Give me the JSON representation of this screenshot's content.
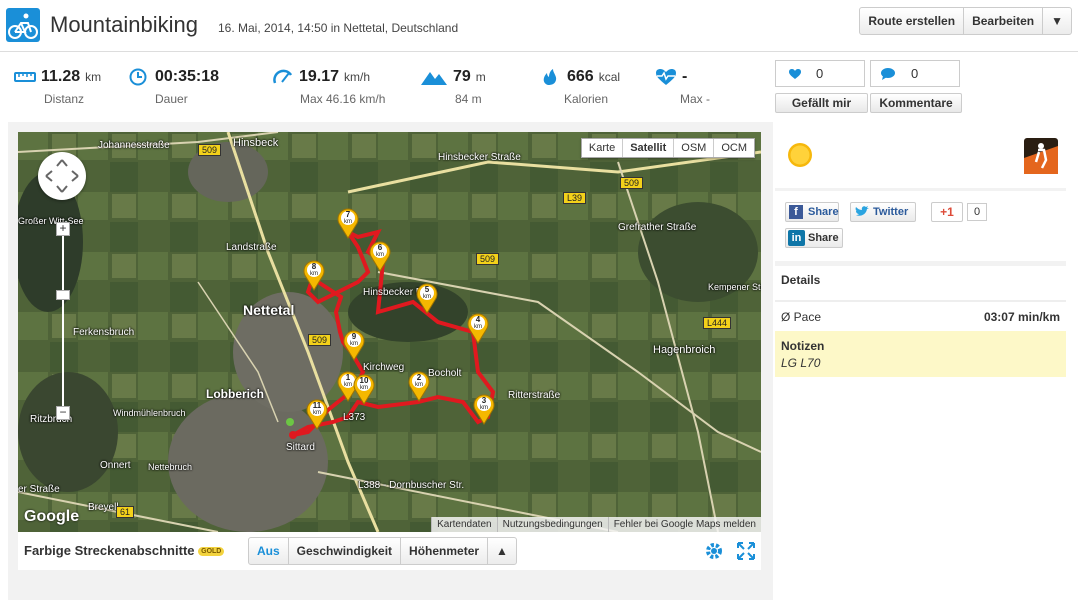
{
  "header": {
    "title": "Mountainbiking",
    "subtitle": "16. Mai, 2014, 14:50 in Nettetal, Deutschland",
    "buttons": {
      "create_route": "Route erstellen",
      "edit": "Bearbeiten",
      "menu": "▼"
    }
  },
  "stats": [
    {
      "icon": "ruler-icon",
      "value": "11.28",
      "unit": "km",
      "label": "Distanz"
    },
    {
      "icon": "clock-icon",
      "value": "00:35:18",
      "unit": "",
      "label": "Dauer"
    },
    {
      "icon": "speedometer-icon",
      "value": "19.17",
      "unit": "km/h",
      "label": "Max 46.16 km/h"
    },
    {
      "icon": "mountain-icon",
      "value": "79",
      "unit": "m",
      "label": "84 m"
    },
    {
      "icon": "flame-icon",
      "value": "666",
      "unit": "kcal",
      "label": "Kalorien"
    },
    {
      "icon": "heartrate-icon",
      "value": "-",
      "unit": "",
      "label": "Max -"
    }
  ],
  "social": {
    "likes": "0",
    "comments": "0",
    "like_label": "Gefällt mir",
    "comment_label": "Kommentare"
  },
  "map": {
    "types": [
      "Karte",
      "Satellit",
      "OSM",
      "OCM"
    ],
    "active_type": "Satellit",
    "zoom_plus": "+",
    "zoom_minus": "−",
    "attribution": [
      "Kartendaten",
      "Nutzungsbedingungen",
      "Fehler bei Google Maps melden"
    ],
    "google_logo": "Google",
    "place_labels": [
      {
        "text": "Nettetal"
      },
      {
        "text": "Lobberich"
      },
      {
        "text": "Hinsbeck"
      },
      {
        "text": "Hagenbroich"
      },
      {
        "text": "Ferkensbruch"
      },
      {
        "text": "Windmühlenbruch"
      },
      {
        "text": "Nettebruch"
      },
      {
        "text": "Onnert"
      },
      {
        "text": "Breyell"
      },
      {
        "text": "Ritzbruch"
      },
      {
        "text": "Johannesstraße"
      },
      {
        "text": "Hinsbecker Straße"
      },
      {
        "text": "Ritterstraße"
      },
      {
        "text": "Sittard"
      },
      {
        "text": "Bocholt"
      },
      {
        "text": "Kirchweg"
      },
      {
        "text": "Großer Witt-See"
      },
      {
        "text": "Landstraße"
      },
      {
        "text": "Grefrather Straße"
      },
      {
        "text": "Kempener Str."
      },
      {
        "text": "L388 - Dornbuscher Str."
      },
      {
        "text": "L373"
      },
      {
        "text": "er Straße"
      },
      {
        "text": "Hinsbecker Berg"
      }
    ],
    "road_badges": [
      "509",
      "509",
      "509",
      "509",
      "61",
      "L39",
      "L444"
    ],
    "markers": [
      "1",
      "2",
      "3",
      "4",
      "5",
      "6",
      "7",
      "8",
      "9",
      "10",
      "11"
    ],
    "marker_unit": "km"
  },
  "segments": {
    "title": "Farbige Streckenabschnitte",
    "badge": "GOLD",
    "options": [
      "Aus",
      "Geschwindigkeit",
      "Höhenmeter",
      "▲"
    ],
    "active": "Aus"
  },
  "share": {
    "facebook": "Share",
    "twitter": "Twitter",
    "gplus": "+1",
    "gplus_count": "0",
    "linkedin": "Share"
  },
  "details": {
    "heading": "Details",
    "pace_label": "Ø Pace",
    "pace_value": "03:07 min/km",
    "notes_label": "Notizen",
    "notes_value": "LG L70"
  },
  "colors": {
    "accent": "#1a8fd8",
    "route": "#e0191f",
    "marker": "#f5b800",
    "notes_bg": "#fdf8c8"
  }
}
